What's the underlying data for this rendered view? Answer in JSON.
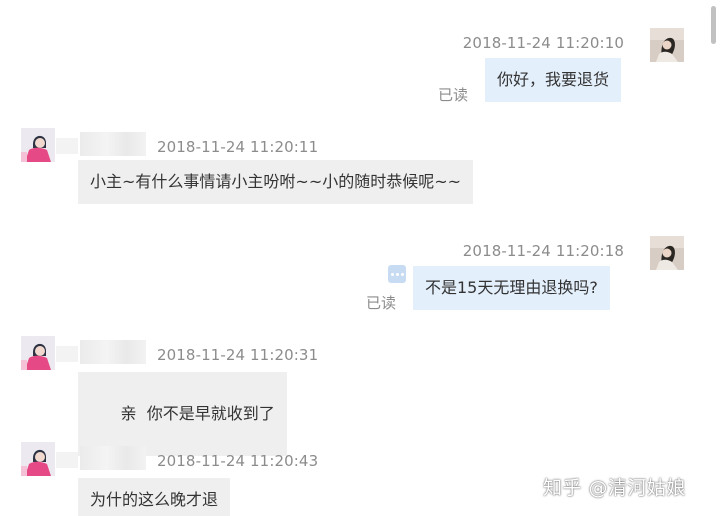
{
  "messages": [
    {
      "sender": "me",
      "timestamp": "2018-11-24 11:20:10",
      "text": "你好，我要退货",
      "status": "已读"
    },
    {
      "sender": "shop",
      "timestamp": "2018-11-24 11:20:11",
      "text": "小主~有什么事情请小主吩咐~~小的随时恭候呢~~"
    },
    {
      "sender": "me",
      "timestamp": "2018-11-24 11:20:18",
      "text": "不是15天无理由退换吗?",
      "status": "已读"
    },
    {
      "sender": "shop",
      "timestamp": "2018-11-24 11:20:31",
      "text": "亲  你不是早就收到了"
    },
    {
      "sender": "shop",
      "timestamp": "2018-11-24 11:20:43",
      "text": "为什的这么晚才退"
    }
  ],
  "icons": {
    "more": "more-options-icon",
    "avatar_me": "user-avatar",
    "avatar_shop": "shop-avatar"
  },
  "colors": {
    "my_bubble": "#e4effc",
    "shop_bubble": "#efefef",
    "timestamp": "#8c8c8c"
  },
  "watermark": "知乎 @清河姑娘"
}
